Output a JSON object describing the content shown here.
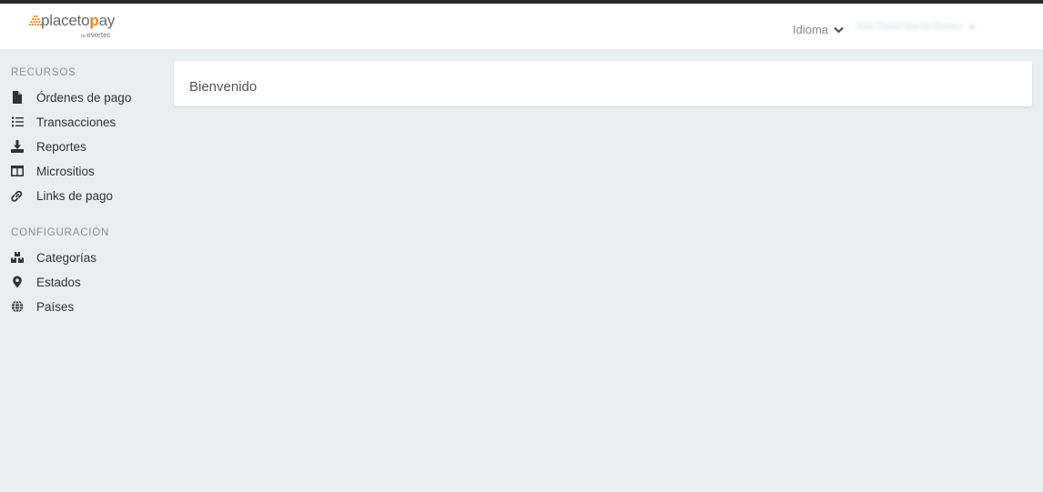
{
  "brand": {
    "name_prefix": "placeto",
    "name_accent": "p",
    "name_suffix": "ay",
    "by": "by",
    "company": "evertec"
  },
  "header": {
    "language_label": "Idioma",
    "user_name": "Juan David Garcia Gomez"
  },
  "sidebar": {
    "sections": [
      {
        "title": "RECURSOS",
        "items": [
          {
            "label": "Órdenes de pago",
            "icon": "file-icon"
          },
          {
            "label": "Transacciones",
            "icon": "list-ol-icon"
          },
          {
            "label": "Reportes",
            "icon": "download-icon"
          },
          {
            "label": "Micrositios",
            "icon": "columns-icon"
          },
          {
            "label": "Links de pago",
            "icon": "link-icon"
          }
        ]
      },
      {
        "title": "CONFIGURACIÓN",
        "items": [
          {
            "label": "Categorías",
            "icon": "cubes-icon"
          },
          {
            "label": "Estados",
            "icon": "map-marker-icon"
          },
          {
            "label": "Países",
            "icon": "globe-icon"
          }
        ]
      }
    ]
  },
  "main": {
    "welcome_title": "Bienvenido"
  },
  "colors": {
    "brand_orange": "#f48220",
    "page_background": "#ebeef1",
    "header_background": "#ffffff"
  }
}
